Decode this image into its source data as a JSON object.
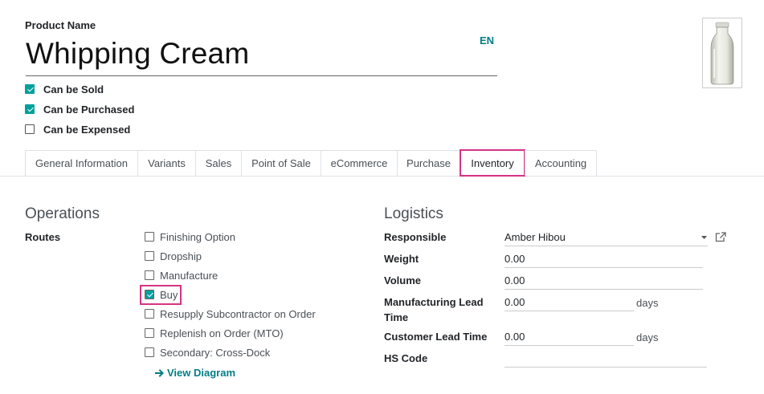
{
  "form": {
    "product_name_label": "Product Name",
    "product_name_value": "Whipping Cream",
    "language_badge": "EN",
    "image_alt": "product-image",
    "options": [
      {
        "label": "Can be Sold",
        "checked": true
      },
      {
        "label": "Can be Purchased",
        "checked": true
      },
      {
        "label": "Can be Expensed",
        "checked": false
      }
    ]
  },
  "tabs": [
    {
      "label": "General Information",
      "active": false
    },
    {
      "label": "Variants",
      "active": false
    },
    {
      "label": "Sales",
      "active": false
    },
    {
      "label": "Point of Sale",
      "active": false
    },
    {
      "label": "eCommerce",
      "active": false
    },
    {
      "label": "Purchase",
      "active": false
    },
    {
      "label": "Inventory",
      "active": true
    },
    {
      "label": "Accounting",
      "active": false
    }
  ],
  "operations": {
    "heading": "Operations",
    "routes_label": "Routes",
    "routes": [
      {
        "label": "Finishing Option",
        "checked": false
      },
      {
        "label": "Dropship",
        "checked": false
      },
      {
        "label": "Manufacture",
        "checked": false
      },
      {
        "label": "Buy",
        "checked": true
      },
      {
        "label": "Resupply Subcontractor on Order",
        "checked": false
      },
      {
        "label": "Replenish on Order (MTO)",
        "checked": false
      },
      {
        "label": "Secondary: Cross-Dock",
        "checked": false
      }
    ],
    "view_diagram": "View Diagram"
  },
  "logistics": {
    "heading": "Logistics",
    "responsible_label": "Responsible",
    "responsible_value": "Amber Hibou",
    "weight_label": "Weight",
    "weight_value": "0.00",
    "volume_label": "Volume",
    "volume_value": "0.00",
    "mfg_lead_label": "Manufacturing Lead Time",
    "mfg_lead_value": "0.00",
    "mfg_lead_suffix": "days",
    "customer_lead_label": "Customer Lead Time",
    "customer_lead_value": "0.00",
    "customer_lead_suffix": "days",
    "hs_code_label": "HS Code",
    "hs_code_value": ""
  },
  "colors": {
    "accent": "#00a09d",
    "link": "#017e84",
    "highlight": "#d63384"
  }
}
